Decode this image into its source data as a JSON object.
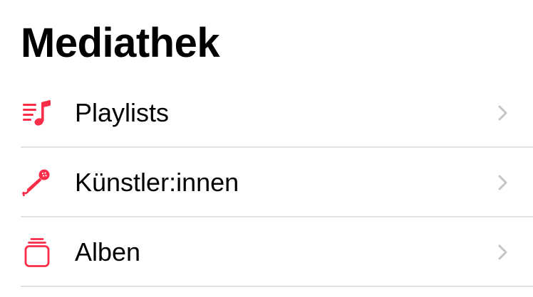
{
  "accent_color": "#fa2d48",
  "chevron_color": "#c4c4c7",
  "divider_color": "#e2e2e6",
  "title": "Mediathek",
  "items": [
    {
      "label": "Playlists",
      "icon": "playlist-music-note-icon"
    },
    {
      "label": "Künstler:innen",
      "icon": "microphone-icon"
    },
    {
      "label": "Alben",
      "icon": "album-stack-icon"
    }
  ]
}
